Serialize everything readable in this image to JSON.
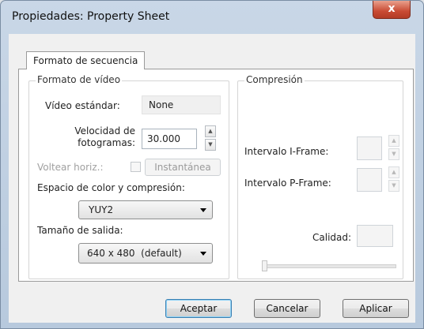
{
  "window": {
    "title": "Propiedades: Property Sheet",
    "close_glyph": "x"
  },
  "tabs": [
    {
      "label": "Formato de secuencia",
      "selected": true
    }
  ],
  "video_format": {
    "group_label": "Formato de vídeo",
    "standard_label": "Vídeo estándar:",
    "standard_value": "None",
    "frame_rate_label_1": "Velocidad de",
    "frame_rate_label_2": "fotogramas:",
    "frame_rate_value": "30.000",
    "flip_label": "Voltear horiz.:",
    "snapshot_label": "Instantánea",
    "color_space_label": "Espacio de color y compresión:",
    "color_space_value": "YUY2",
    "output_size_label": "Tamaño de salida:",
    "output_size_value": "640 x 480  (default)"
  },
  "compression": {
    "group_label": "Compresión",
    "i_frame_label": "Intervalo I-Frame:",
    "i_frame_value": "",
    "p_frame_label": "Intervalo P-Frame:",
    "p_frame_value": "",
    "quality_label": "Calidad:",
    "quality_value": ""
  },
  "buttons": {
    "ok": "Aceptar",
    "cancel": "Cancelar",
    "apply": "Aplicar"
  }
}
